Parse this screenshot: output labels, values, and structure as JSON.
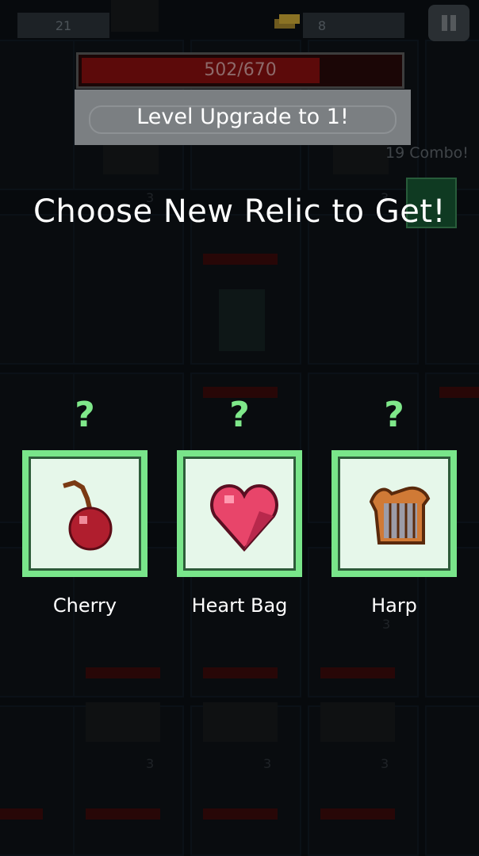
{
  "hud": {
    "left_counter": "21",
    "center_counter": "8",
    "pause_icon": "pause-icon"
  },
  "hp": {
    "text": "502/670",
    "current": 502,
    "max": 670
  },
  "banner": {
    "text": "Level Upgrade to 1!"
  },
  "combo": {
    "text": "19 Combo!"
  },
  "title": "Choose New Relic to Get!",
  "relics": [
    {
      "name": "Cherry",
      "question": "?",
      "icon": "cherry-icon"
    },
    {
      "name": "Heart Bag",
      "question": "?",
      "icon": "heart-bag-icon"
    },
    {
      "name": "Harp",
      "question": "?",
      "icon": "harp-icon"
    }
  ],
  "background": {
    "numbers": [
      "3",
      "3",
      "3",
      "3",
      "3",
      "3"
    ]
  },
  "colors": {
    "accent_green": "#79e58a",
    "question_green": "#7fe88a",
    "hp_red": "#5c0a0a"
  }
}
